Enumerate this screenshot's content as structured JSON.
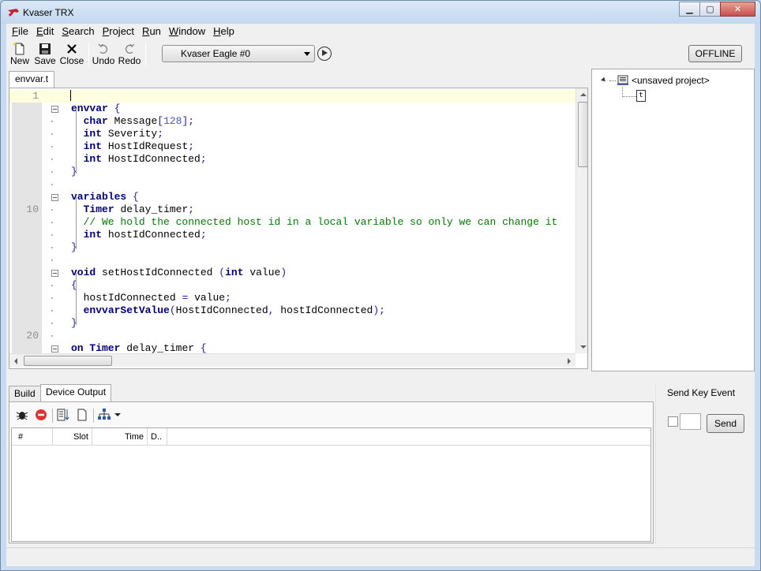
{
  "window": {
    "title": "Kvaser TRX",
    "minimize_glyph": "▁",
    "maximize_glyph": "▢",
    "close_glyph": "✕"
  },
  "menu": {
    "items": [
      {
        "hot": "F",
        "rest": "ile"
      },
      {
        "hot": "E",
        "rest": "dit"
      },
      {
        "hot": "S",
        "rest": "earch"
      },
      {
        "hot": "P",
        "rest": "roject"
      },
      {
        "hot": "R",
        "rest": "un"
      },
      {
        "hot": "W",
        "rest": "indow"
      },
      {
        "hot": "H",
        "rest": "elp"
      }
    ]
  },
  "toolbar": {
    "new_label": "New",
    "save_label": "Save",
    "close_label": "Close",
    "undo_label": "Undo",
    "redo_label": "Redo",
    "device": "Kvaser Eagle #0",
    "offline_label": "OFFLINE"
  },
  "editor": {
    "tab_label": "envvar.t",
    "line_numbers": [
      "1",
      "10",
      "20"
    ]
  },
  "project": {
    "root_label": "<unsaved project>",
    "child_file_glyph": "t"
  },
  "bottom": {
    "tabs": [
      "Build",
      "Device Output"
    ],
    "active_tab": "Device Output",
    "columns": [
      "#",
      "Slot",
      "Time",
      "D.."
    ]
  },
  "send_key": {
    "title": "Send Key Event",
    "button_label": "Send"
  },
  "colors": {
    "keyword": "#00007f",
    "comment": "#008000",
    "current_line": "#ffffe0",
    "linenum_bg": "#e4e4e4"
  }
}
